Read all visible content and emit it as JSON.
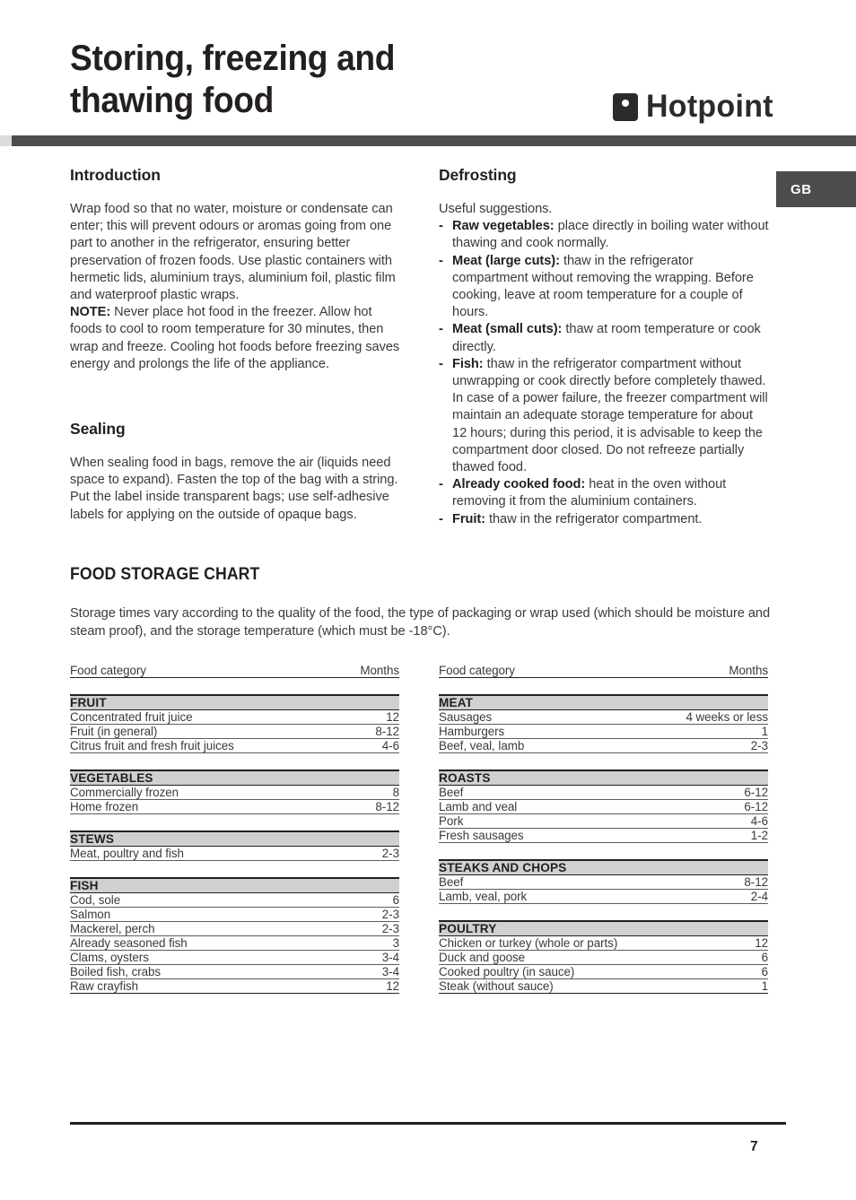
{
  "header": {
    "title": "Storing, freezing and thawing food",
    "brand": "Hotpoint",
    "brand_mark_icon": "hotpoint-square-dot-icon",
    "rule_color": "#4d4d4d"
  },
  "language_badge": {
    "label": "GB",
    "background": "#4d4d4d",
    "text_color": "#ffffff"
  },
  "left_column": {
    "introduction": {
      "heading": "Introduction",
      "paragraph": "Wrap food so that no water, moisture or condensate can enter; this will prevent odours or aromas going from one part to another in the refrigerator, ensuring better preservation of frozen foods. Use plastic containers with hermetic lids, aluminium trays, aluminium foil, plastic film and waterproof plastic wraps.",
      "note_label": "NOTE:",
      "note_text": " Never place hot food in the freezer. Allow hot foods to cool to room temperature for 30 minutes, then wrap and freeze. Cooling hot foods before freezing saves energy and prolongs the life of the appliance."
    },
    "sealing": {
      "heading": "Sealing",
      "paragraph": "When sealing food in bags, remove the air (liquids need space to expand). Fasten the top of the bag with a string. Put the label inside transparent bags; use self-adhesive labels for applying on the outside of opaque bags."
    }
  },
  "right_column": {
    "defrosting": {
      "heading": "Defrosting",
      "intro": "Useful suggestions.",
      "dash": "-",
      "items": [
        {
          "label": "Raw vegetables:",
          "text": " place directly in boiling water without thawing and cook normally."
        },
        {
          "label": "Meat (large cuts):",
          "text": " thaw in the refrigerator compartment without removing the wrapping. Before cooking, leave at room temperature for a couple of hours."
        },
        {
          "label": "Meat (small cuts):",
          "text": " thaw at room temperature or cook directly."
        },
        {
          "label": "Fish:",
          "text": " thaw in the refrigerator compartment without unwrapping or cook directly before completely thawed. In case of a power failure, the freezer compartment will maintain an adequate storage temperature for about 12 hours; during this period, it is advisable to keep the compartment door closed. Do not refreeze partially thawed food."
        },
        {
          "label": "Already cooked food:",
          "text": " heat in the oven without removing it from the aluminium containers."
        },
        {
          "label": "Fruit:",
          "text": " thaw in the refrigerator compartment."
        }
      ]
    }
  },
  "food_storage_chart": {
    "title": "FOOD STORAGE CHART",
    "intro": "Storage times vary according to the quality of the food, the type of packaging or wrap used (which should be moisture and steam proof), and the storage temperature (which must be -18°C).",
    "columns": [
      "Food category",
      "Months"
    ],
    "header_background": "#d0d0d0",
    "left_table": [
      {
        "category": "FRUIT",
        "rows": [
          {
            "item": "Concentrated fruit juice",
            "months": "12"
          },
          {
            "item": "Fruit (in general)",
            "months": "8-12"
          },
          {
            "item": "Citrus fruit and fresh fruit juices",
            "months": "4-6"
          }
        ]
      },
      {
        "category": "VEGETABLES",
        "rows": [
          {
            "item": "Commercially frozen",
            "months": "8"
          },
          {
            "item": "Home frozen",
            "months": "8-12"
          }
        ]
      },
      {
        "category": "STEWS",
        "rows": [
          {
            "item": "Meat, poultry and fish",
            "months": "2-3"
          }
        ]
      },
      {
        "category": "FISH",
        "rows": [
          {
            "item": "Cod, sole",
            "months": "6"
          },
          {
            "item": "Salmon",
            "months": "2-3"
          },
          {
            "item": "Mackerel, perch",
            "months": "2-3"
          },
          {
            "item": "Already seasoned fish",
            "months": "3"
          },
          {
            "item": "Clams, oysters",
            "months": "3-4"
          },
          {
            "item": "Boiled fish, crabs",
            "months": "3-4"
          },
          {
            "item": "Raw crayfish",
            "months": "12"
          }
        ]
      }
    ],
    "right_table": [
      {
        "category": "MEAT",
        "rows": [
          {
            "item": "Sausages",
            "months": "4 weeks or less"
          },
          {
            "item": "Hamburgers",
            "months": "1"
          },
          {
            "item": "Beef, veal, lamb",
            "months": "2-3"
          }
        ]
      },
      {
        "category": "ROASTS",
        "rows": [
          {
            "item": "Beef",
            "months": "6-12"
          },
          {
            "item": "Lamb and veal",
            "months": "6-12"
          },
          {
            "item": "Pork",
            "months": "4-6"
          },
          {
            "item": "Fresh sausages",
            "months": "1-2"
          }
        ]
      },
      {
        "category": "STEAKS AND CHOPS",
        "rows": [
          {
            "item": "Beef",
            "months": "8-12"
          },
          {
            "item": "Lamb, veal, pork",
            "months": "2-4"
          }
        ]
      },
      {
        "category": "POULTRY",
        "rows": [
          {
            "item": "Chicken or turkey (whole or parts)",
            "months": "12"
          },
          {
            "item": "Duck and goose",
            "months": "6"
          },
          {
            "item": "Cooked poultry (in sauce)",
            "months": "6"
          },
          {
            "item": "Steak (without sauce)",
            "months": "1"
          }
        ]
      }
    ]
  },
  "footer": {
    "page_number": "7"
  }
}
